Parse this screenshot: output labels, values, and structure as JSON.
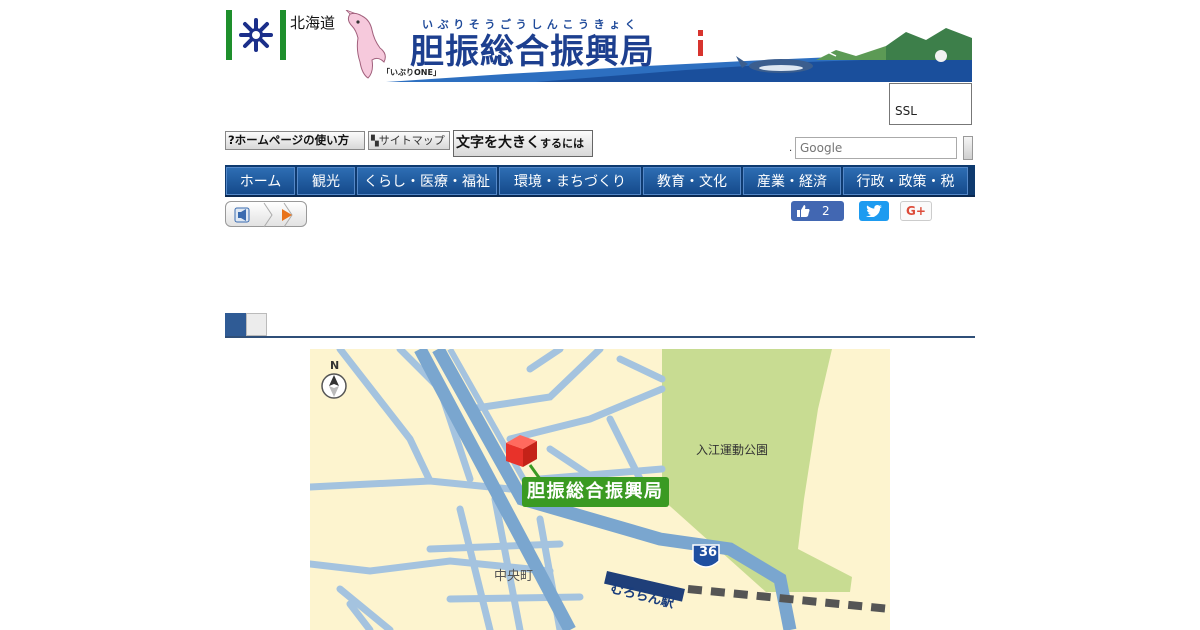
{
  "header": {
    "pref_name": "北海道",
    "ruby": "いぶりそうごうしんこうきょく",
    "title": "胆振総合振興局",
    "mascot_label": "「いぶりONE」",
    "ssl_label": "SSL"
  },
  "utility": {
    "how_to_use": "?ホームページの使い方",
    "sitemap": "サイトマップ",
    "bigtext_main": "文字を大きく",
    "bigtext_small": "するには"
  },
  "search": {
    "dot": ".",
    "placeholder": "Google"
  },
  "nav": {
    "items": [
      "ホーム",
      "観光",
      "くらし・医療・福祉",
      "環境・まちづくり",
      "教育・文化",
      "産業・経済",
      "行政・政策・税"
    ]
  },
  "social": {
    "like_count": "2",
    "gplus_label": "G+"
  },
  "map": {
    "park_label": "入江運動公園",
    "town_label": "中央町",
    "station_label": "むろらん駅",
    "office_label": "胆振総合振興局",
    "compass_label": "N",
    "route_number": "36"
  },
  "colors": {
    "nav_bg": "#0e3a6f",
    "title_blue": "#1d3f8f",
    "office_green": "#3a9a22",
    "map_bg": "#fdf4cf",
    "park_green": "#c8dc92",
    "road_blue": "#a4c3df"
  }
}
